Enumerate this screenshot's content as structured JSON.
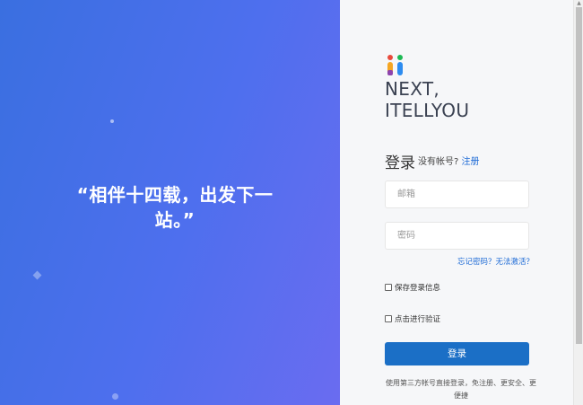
{
  "hero": {
    "slogan": "“相伴十四载，出发下一站。”"
  },
  "brand": {
    "line1": "NEXT,",
    "line2": "ITELLYOU"
  },
  "login": {
    "title": "登录",
    "no_account": "没有帐号?",
    "register_link": "注册",
    "email_placeholder": "邮箱",
    "password_placeholder": "密码",
    "forgot_link": "忘记密码？无法激活？",
    "remember_label": "保存登录信息",
    "verify_label": "点击进行验证",
    "submit_label": "登录",
    "third_party_note": "使用第三方帐号直接登录，免注册、更安全、更便捷"
  },
  "colors": {
    "gradient_start": "#3a6fe0",
    "gradient_end": "#6a6cf0",
    "accent": "#1b6fc6",
    "link": "#1e6bd6"
  }
}
